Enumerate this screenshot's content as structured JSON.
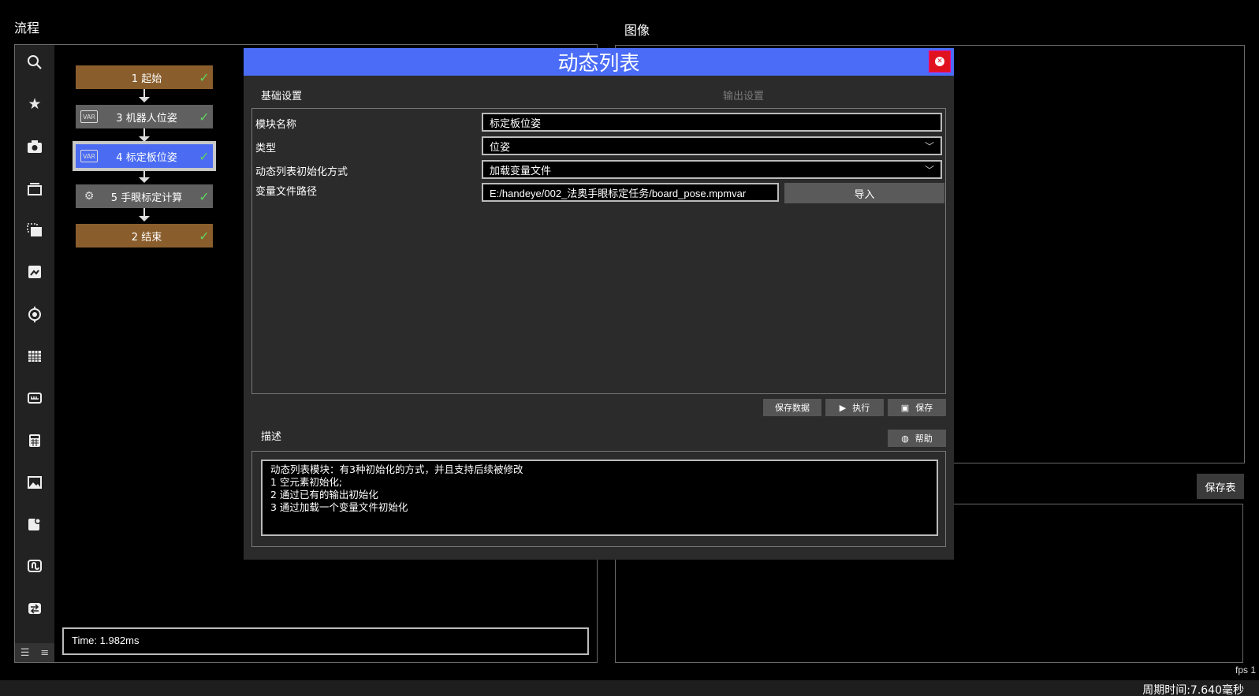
{
  "flow": {
    "title": "流程",
    "nodes": [
      {
        "label": "1 起始",
        "style": "brown",
        "icon": ""
      },
      {
        "label": "3 机器人位姿",
        "style": "gray",
        "icon": "VAR"
      },
      {
        "label": "4 标定板位姿",
        "style": "selected",
        "icon": "VAR"
      },
      {
        "label": "5 手眼标定计算",
        "style": "gray",
        "icon": "robot"
      },
      {
        "label": "2 结束",
        "style": "brown",
        "icon": ""
      }
    ],
    "time": "Time: 1.982ms",
    "toolbar_icons": [
      "search-icon",
      "star-icon",
      "camera-icon",
      "stack-icon",
      "crop-icon",
      "image-edit-icon",
      "target-icon",
      "grid-icon",
      "ruler-icon",
      "calculator-icon",
      "picture-icon",
      "chart-icon",
      "loop-icon",
      "transfer-icon"
    ]
  },
  "image": {
    "title": "图像",
    "save_table": "保存表",
    "fps": "fps 1",
    "cycle_time": "周期时间:7.640毫秒"
  },
  "dialog": {
    "title": "动态列表",
    "tabs": {
      "basic": "基础设置",
      "output": "输出设置"
    },
    "fields": {
      "module_name_label": "模块名称",
      "module_name_value": "标定板位姿",
      "type_label": "类型",
      "type_value": "位姿",
      "init_label": "动态列表初始化方式",
      "init_value": "加载变量文件",
      "path_label": "变量文件路径",
      "path_value": "E:/handeye/002_法奥手眼标定任务/board_pose.mpmvar",
      "import_btn": "导入"
    },
    "buttons": {
      "save_data": "保存数据",
      "execute": "执行",
      "save": "保存",
      "help": "帮助"
    },
    "desc_title": "描述",
    "description": "动态列表模块：有3种初始化的方式，并且支持后续被修改\n1 空元素初始化;\n2 通过已有的输出初始化\n3 通过加载一个变量文件初始化"
  }
}
